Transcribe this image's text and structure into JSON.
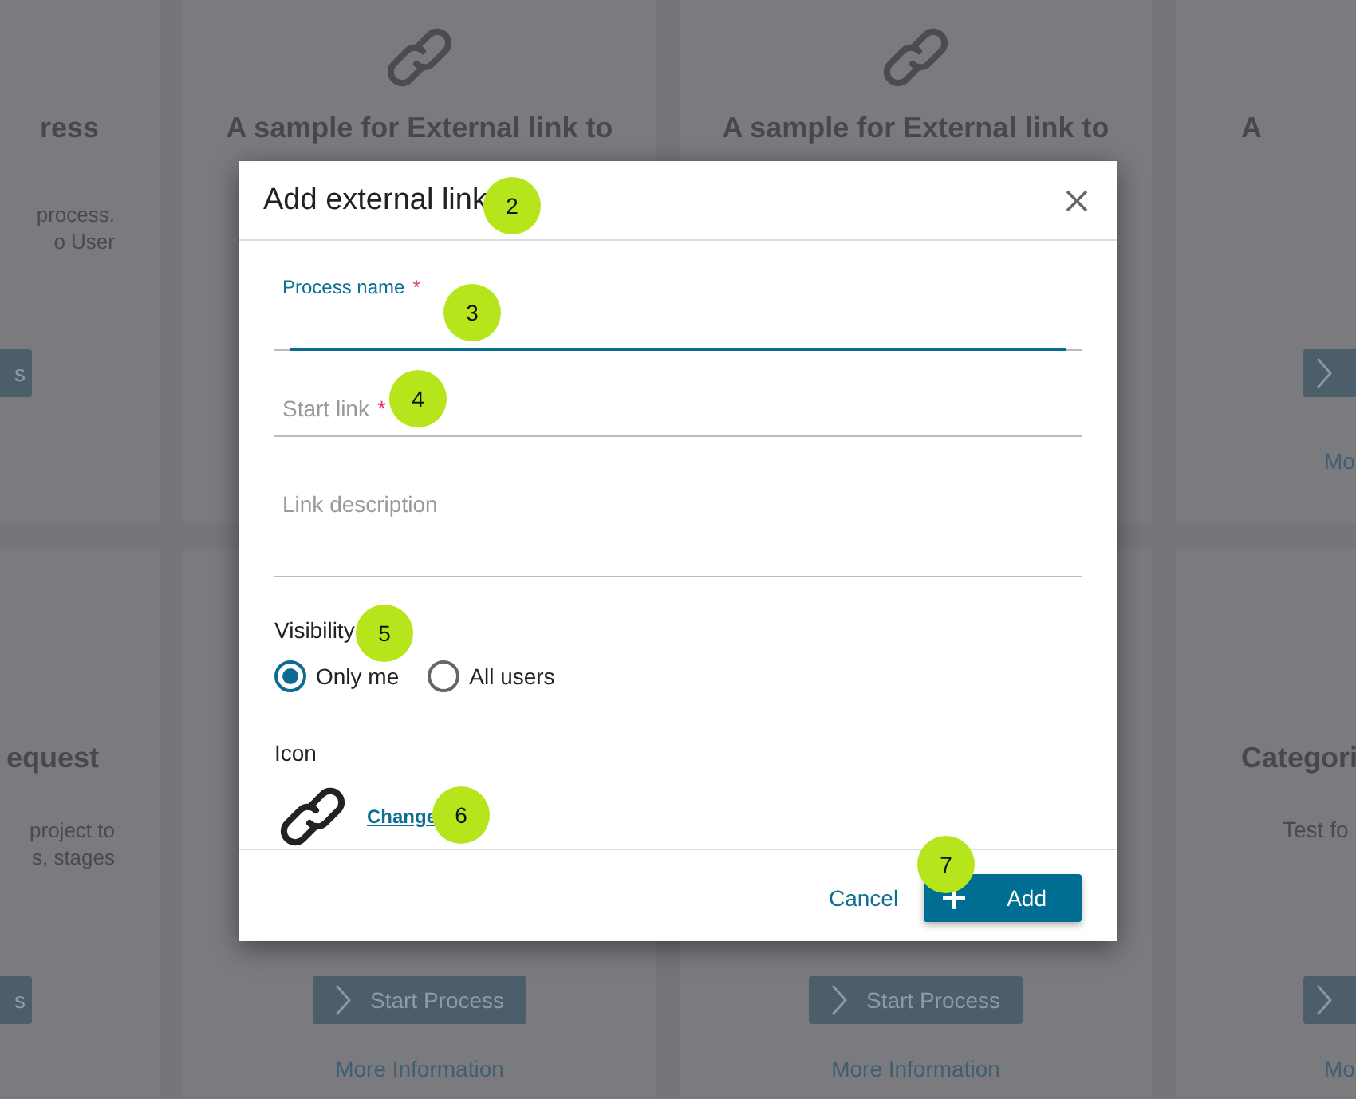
{
  "backdrop": {
    "rows": [
      {
        "cards": [
          {
            "kind": "cut_left",
            "title": "ress",
            "description": [
              "process.",
              "o User"
            ],
            "button": {
              "label": "s"
            }
          },
          {
            "kind": "full",
            "icon": true,
            "title": "A sample for External link to"
          },
          {
            "kind": "full",
            "icon": true,
            "title": "A sample for External link to"
          },
          {
            "kind": "cut_right",
            "title": "A",
            "button": {
              "chevron": true
            },
            "more": "Mo"
          }
        ]
      },
      {
        "cards": [
          {
            "kind": "cut_left",
            "title": "equest",
            "description": [
              "project to",
              "s, stages"
            ],
            "button": {
              "label": "s"
            }
          },
          {
            "kind": "full",
            "button": {
              "label": "Start Process",
              "chevron": true
            },
            "more": "More Information"
          },
          {
            "kind": "full",
            "button": {
              "label": "Start Process",
              "chevron": true
            },
            "more": "More Information"
          },
          {
            "kind": "cut_right",
            "title": "Categori",
            "description": [
              "Test fo"
            ],
            "button": {
              "chevron": true
            },
            "more": "Mo"
          }
        ]
      }
    ]
  },
  "dialog": {
    "title": "Add external link",
    "title_callout": "2",
    "fields": [
      {
        "kind": "input",
        "label": "Process name",
        "required_mark": "*",
        "focused": true,
        "callout": "3"
      },
      {
        "kind": "input",
        "label": "Start link",
        "required_mark": "*",
        "focused": false,
        "callout": "4"
      },
      {
        "kind": "textarea",
        "label": "Link description",
        "focused": false
      }
    ],
    "visibility": {
      "label": "Visibility",
      "callout": "5",
      "options": [
        {
          "label": "Only me",
          "selected": true
        },
        {
          "label": "All users",
          "selected": false
        }
      ]
    },
    "icon": {
      "label": "Icon",
      "change": "Change",
      "callout": "6"
    },
    "buttons": [
      {
        "kind": "link",
        "label": "Cancel"
      },
      {
        "kind": "primary",
        "label": "Add",
        "callout": "7"
      }
    ]
  }
}
